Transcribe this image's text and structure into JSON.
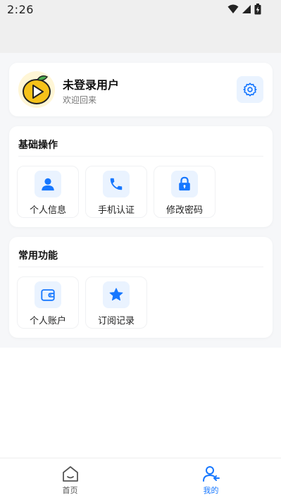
{
  "status_bar": {
    "time": "2:26"
  },
  "profile": {
    "name": "未登录用户",
    "subtitle": "欢迎回来"
  },
  "sections": [
    {
      "title": "基础操作",
      "items": [
        {
          "label": "个人信息",
          "icon": "user-icon"
        },
        {
          "label": "手机认证",
          "icon": "phone-icon"
        },
        {
          "label": "修改密码",
          "icon": "lock-icon"
        }
      ]
    },
    {
      "title": "常用功能",
      "items": [
        {
          "label": "个人账户",
          "icon": "wallet-icon"
        },
        {
          "label": "订阅记录",
          "icon": "star-icon"
        }
      ]
    }
  ],
  "tabbar": {
    "items": [
      {
        "label": "首页",
        "icon": "home-icon",
        "active": false
      },
      {
        "label": "我的",
        "icon": "user-icon",
        "active": true
      }
    ]
  },
  "colors": {
    "accent": "#1677ff",
    "icon_bg": "#eaf3ff",
    "tab_inactive": "#555555"
  }
}
